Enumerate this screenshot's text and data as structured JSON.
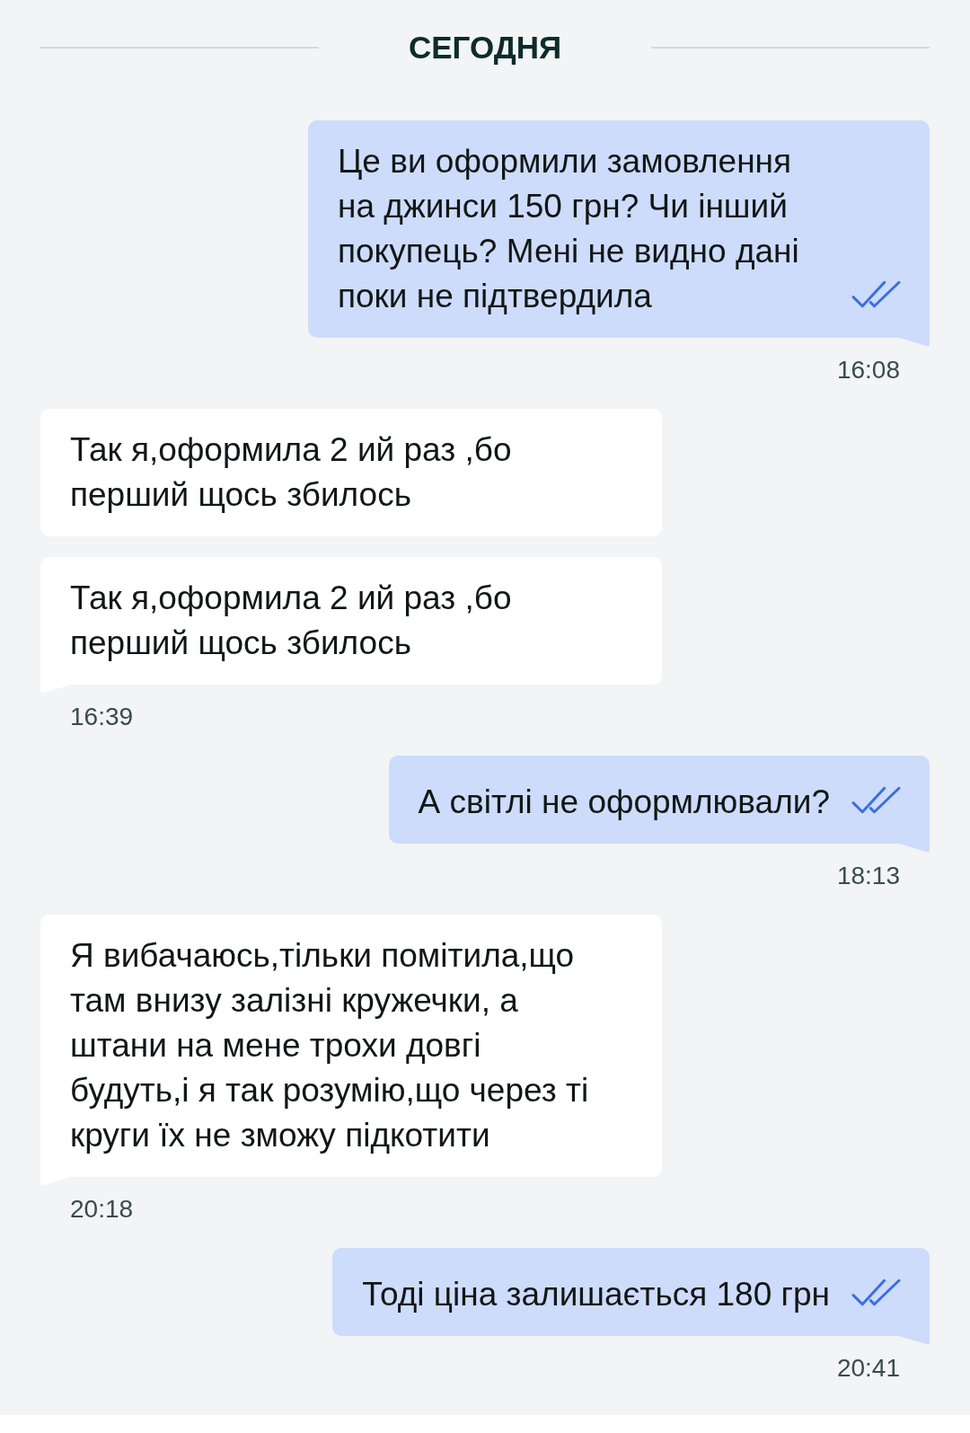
{
  "date_divider": {
    "label": "СЕГОДНЯ"
  },
  "messages": [
    {
      "kind": "outgoing",
      "text": "Це ви оформили замовлення на джинси 150 грн? Чи інший покупець? Мені не видно дані поки не підтвердила",
      "read": true,
      "tail": true,
      "time": "16:08"
    },
    {
      "kind": "incoming",
      "text": "Так я,оформила 2 ий раз ,бо перший щось збилось",
      "tail": false
    },
    {
      "kind": "incoming",
      "text": "Так я,оформила 2 ий раз ,бо перший щось збилось",
      "tail": true,
      "time": "16:39"
    },
    {
      "kind": "outgoing",
      "text": "А світлі не оформлювали?",
      "read": true,
      "tail": true,
      "time": "18:13"
    },
    {
      "kind": "incoming",
      "text": "Я вибачаюсь,тільки помітила,що там внизу залізні кружечки, а штани на мене трохи довгі будуть,і я так розумію,що через ті круги їх не зможу підкотити",
      "tail": true,
      "time": "20:18"
    },
    {
      "kind": "outgoing",
      "text": "Тоді ціна залишається 180 грн",
      "read": true,
      "tail": true,
      "time": "20:41"
    }
  ]
}
